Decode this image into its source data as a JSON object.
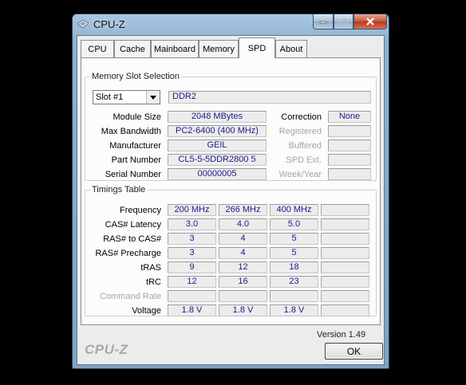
{
  "window": {
    "title": "CPU-Z"
  },
  "tabs": [
    {
      "label": "CPU"
    },
    {
      "label": "Cache"
    },
    {
      "label": "Mainboard"
    },
    {
      "label": "Memory"
    },
    {
      "label": "SPD",
      "active": true
    },
    {
      "label": "About"
    }
  ],
  "slot_section": {
    "legend": "Memory Slot Selection",
    "slot_select": "Slot #1",
    "memory_type": "DDR2",
    "rows": [
      {
        "label": "Module Size",
        "value": "2048 MBytes",
        "right_label": "Correction",
        "right_value": "None",
        "right_enabled": true
      },
      {
        "label": "Max Bandwidth",
        "value": "PC2-6400 (400 MHz)",
        "right_label": "Registered",
        "right_value": "",
        "right_enabled": false
      },
      {
        "label": "Manufacturer",
        "value": "GEIL",
        "right_label": "Buffered",
        "right_value": "",
        "right_enabled": false
      },
      {
        "label": "Part Number",
        "value": "CL5-5-5DDR2800  5",
        "right_label": "SPD Ext.",
        "right_value": "",
        "right_enabled": false
      },
      {
        "label": "Serial Number",
        "value": "00000005",
        "right_label": "Week/Year",
        "right_value": "",
        "right_enabled": false
      }
    ]
  },
  "timings": {
    "legend": "Timings Table",
    "rows": [
      {
        "label": "Frequency",
        "values": [
          "200 MHz",
          "266 MHz",
          "400 MHz",
          ""
        ],
        "enabled": true
      },
      {
        "label": "CAS# Latency",
        "values": [
          "3.0",
          "4.0",
          "5.0",
          ""
        ],
        "enabled": true
      },
      {
        "label": "RAS# to CAS#",
        "values": [
          "3",
          "4",
          "5",
          ""
        ],
        "enabled": true
      },
      {
        "label": "RAS# Precharge",
        "values": [
          "3",
          "4",
          "5",
          ""
        ],
        "enabled": true
      },
      {
        "label": "tRAS",
        "values": [
          "9",
          "12",
          "18",
          ""
        ],
        "enabled": true
      },
      {
        "label": "tRC",
        "values": [
          "12",
          "16",
          "23",
          ""
        ],
        "enabled": true
      },
      {
        "label": "Command Rate",
        "values": [
          "",
          "",
          "",
          ""
        ],
        "enabled": false
      },
      {
        "label": "Voltage",
        "values": [
          "1.8 V",
          "1.8 V",
          "1.8 V",
          ""
        ],
        "enabled": true
      }
    ]
  },
  "footer": {
    "version": "Version 1.49",
    "brand": "CPU-Z",
    "ok_label": "OK"
  },
  "colors": {
    "value_text": "#1a1a8c",
    "disabled_label": "#a5a5a5"
  }
}
